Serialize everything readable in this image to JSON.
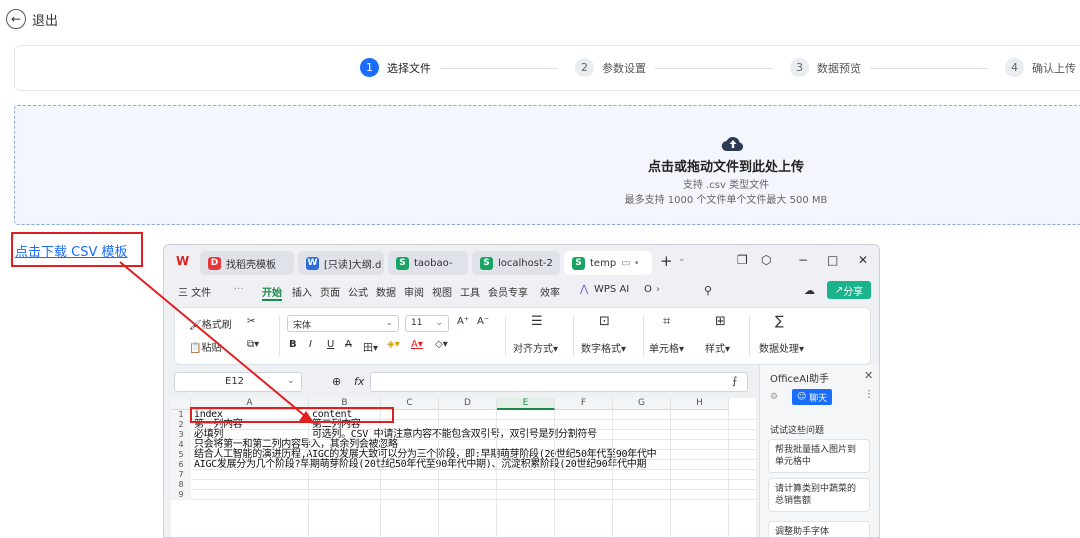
{
  "header": {
    "back_icon": "arrow-left-icon",
    "back_label": "退出"
  },
  "steps": [
    {
      "num": "1",
      "label": "选择文件",
      "active": true
    },
    {
      "num": "2",
      "label": "参数设置",
      "active": false
    },
    {
      "num": "3",
      "label": "数据预览",
      "active": false
    },
    {
      "num": "4",
      "label": "确认上传",
      "active": false
    }
  ],
  "upload": {
    "icon": "cloud-upload-icon",
    "title": "点击或拖动文件到此处上传",
    "subtitle": "支持 .csv 类型文件",
    "limit": "最多支持 1000 个文件单个文件最大 500 MB"
  },
  "template_link": "点击下载 CSV 模板",
  "colors": {
    "accent": "#1a6dff",
    "annotation": "#e02020",
    "wps_green": "#19b38c"
  },
  "wps": {
    "tabs": [
      {
        "label": "找稻壳模板",
        "icon_text": "D",
        "color": "#e5383b"
      },
      {
        "label": "[只读]大纲.d",
        "icon_text": "W",
        "color": "#2b6cde"
      },
      {
        "label": "taobao-",
        "icon_text": "S",
        "color": "#19a463"
      },
      {
        "label": "localhost-2",
        "icon_text": "S",
        "color": "#19a463"
      },
      {
        "label": "temp",
        "icon_text": "S",
        "color": "#19a463"
      }
    ],
    "menu": [
      "三 文件",
      "···",
      "开始",
      "插入",
      "页面",
      "公式",
      "数据",
      "审阅",
      "视图",
      "工具",
      "会员专享",
      "效率",
      "WPS AI",
      "O"
    ],
    "share_label": "分享",
    "ribbon": {
      "format_painter": "格式刷",
      "paste": "粘贴",
      "font": "宋体",
      "font_size": "11",
      "align": "对齐方式",
      "number_format": "数字格式",
      "cell": "单元格",
      "style": "样式",
      "data_process": "数据处理"
    },
    "name_box": "E12",
    "fx": "fx",
    "columns": [
      "A",
      "B",
      "C",
      "D",
      "E",
      "F",
      "G",
      "H"
    ],
    "selected_column": "E",
    "rows": [
      {
        "n": "1",
        "a": "index",
        "b": "content"
      },
      {
        "n": "2",
        "a": "第一列内容",
        "b": "第二列内容"
      },
      {
        "n": "3",
        "a": "必填列",
        "b": "可选列。CSV 中请注意内容不能包含双引号，双引号是列分割符号"
      },
      {
        "n": "4",
        "a": "只会将第一和第二列内容导入，其余列会被忽略",
        "b": ""
      },
      {
        "n": "5",
        "a": "结合人工智能的演进历程,AIGC的发展大致可以分为三个阶段，即:早期萌芽阶段(20世纪50年代至90年代中",
        "b": ""
      },
      {
        "n": "6",
        "a": "AIGC发展分为几个阶段?早期萌芽阶段(20世纪50年代至90年代中期)、沉淀积累阶段(20世纪90年代中期",
        "b": ""
      },
      {
        "n": "7",
        "a": "",
        "b": ""
      },
      {
        "n": "8",
        "a": "",
        "b": ""
      },
      {
        "n": "9",
        "a": "",
        "b": ""
      }
    ],
    "panel": {
      "title": "OfficeAI助手",
      "chat": "聊天",
      "hint": "试试这些问题",
      "cards": [
        "帮我批量插入图片到单元格中",
        "请计算类别中蔬菜的总销售额",
        "调整助手字体"
      ]
    }
  }
}
